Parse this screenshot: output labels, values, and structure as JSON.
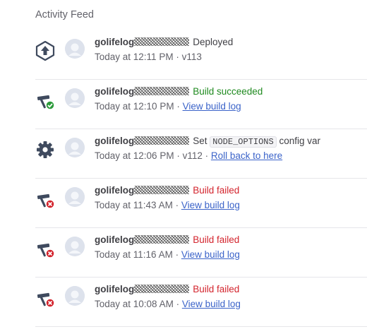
{
  "feed": {
    "title": "Activity Feed",
    "items": [
      {
        "icon": "deploy-upload-icon",
        "user": "golifelog",
        "action": "Deployed",
        "time": "Today at 12:11 PM",
        "sep": " · ",
        "version": "v113"
      },
      {
        "icon": "build-success-icon",
        "user": "golifelog",
        "action": "Build succeeded",
        "time": "Today at 12:10 PM",
        "sep": " · ",
        "link": "View build log"
      },
      {
        "icon": "gear-icon",
        "user": "golifelog",
        "action_pre": "Set",
        "code": "NODE_OPTIONS",
        "action_post": "config var",
        "time": "Today at 12:06 PM",
        "sep": " · ",
        "version": "v112",
        "sep2": " · ",
        "link": "Roll back to here"
      },
      {
        "icon": "build-failed-icon",
        "user": "golifelog",
        "action": "Build failed",
        "time": "Today at 11:43 AM",
        "sep": " · ",
        "link": "View build log"
      },
      {
        "icon": "build-failed-icon",
        "user": "golifelog",
        "action": "Build failed",
        "time": "Today at 11:16 AM",
        "sep": " · ",
        "link": "View build log"
      },
      {
        "icon": "build-failed-icon",
        "user": "golifelog",
        "action": "Build failed",
        "time": "Today at 10:08 AM",
        "sep": " · ",
        "link": "View build log"
      }
    ]
  },
  "colors": {
    "success": "#1f8a1f",
    "failure": "#d3242d",
    "link": "#3b63c9",
    "icon": "#3f4a5e"
  }
}
